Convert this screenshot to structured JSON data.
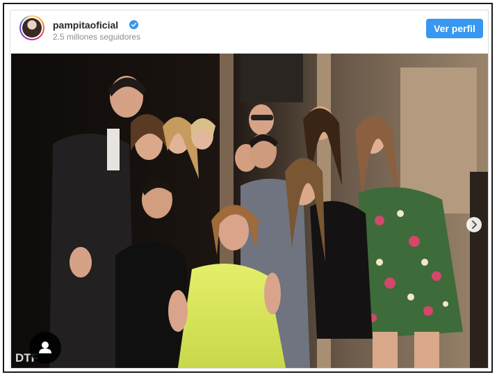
{
  "post": {
    "username": "pampitaoficial",
    "followers": "2.5 millones seguidores",
    "view_profile_label": "Ver perfil",
    "verified_icon": "verified-badge-icon",
    "watermark": "DTF"
  },
  "icons": {
    "user_tag": "user-icon",
    "next": "chevron-right-icon"
  },
  "colors": {
    "accent": "#3897f0",
    "verified": "#3897f0",
    "border": "#dbdbdb"
  }
}
